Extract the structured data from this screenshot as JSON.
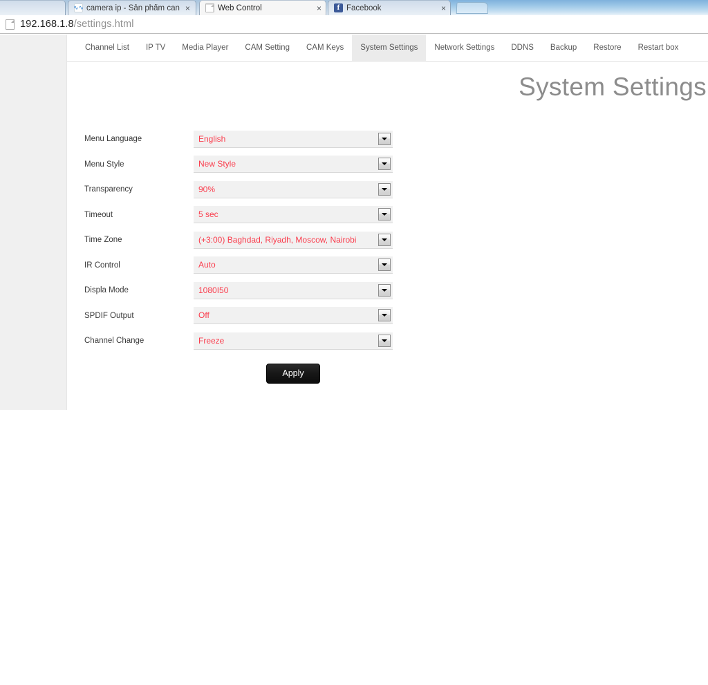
{
  "browser": {
    "tabs": [
      {
        "title": "",
        "favicon": "page-icon",
        "truncated": true,
        "active": false
      },
      {
        "title": "camera ip - Sản phẩm can",
        "favicon": "camera-icon",
        "truncated": true,
        "active": false
      },
      {
        "title": "Web Control",
        "favicon": "page-icon",
        "truncated": false,
        "active": true
      },
      {
        "title": "Facebook",
        "favicon": "facebook-icon",
        "truncated": false,
        "active": false
      }
    ],
    "close_glyph": "×",
    "new_tab_label": "",
    "address": {
      "host": "192.168.1.8",
      "path": "/settings.html",
      "icon": "document-icon"
    }
  },
  "nav": {
    "items": [
      {
        "label": "Channel List",
        "active": false
      },
      {
        "label": "IP TV",
        "active": false
      },
      {
        "label": "Media Player",
        "active": false
      },
      {
        "label": "CAM Setting",
        "active": false
      },
      {
        "label": "CAM Keys",
        "active": false
      },
      {
        "label": "System Settings",
        "active": true
      },
      {
        "label": "Network Settings",
        "active": false
      },
      {
        "label": "DDNS",
        "active": false
      },
      {
        "label": "Backup",
        "active": false
      },
      {
        "label": "Restore",
        "active": false
      },
      {
        "label": "Restart box",
        "active": false
      }
    ]
  },
  "main": {
    "title": "System Settings",
    "fields": [
      {
        "label": "Menu Language",
        "value": "English"
      },
      {
        "label": "Menu Style",
        "value": "New Style"
      },
      {
        "label": "Transparency",
        "value": "90%"
      },
      {
        "label": "Timeout",
        "value": "5 sec"
      },
      {
        "label": "Time Zone",
        "value": "(+3:00) Baghdad, Riyadh, Moscow, Nairobi"
      },
      {
        "label": "IR Control",
        "value": "Auto"
      },
      {
        "label": "Displa Mode",
        "value": "1080I50"
      },
      {
        "label": "SPDIF Output",
        "value": "Off"
      },
      {
        "label": "Channel Change",
        "value": "Freeze"
      }
    ],
    "apply_label": "Apply"
  },
  "colors": {
    "value_red": "#fa3c4c",
    "title_gray": "#8c8c8c",
    "field_bg": "#f1f1f1",
    "active_tab_bg": "#ebebeb",
    "apply_bg": "#161616"
  }
}
